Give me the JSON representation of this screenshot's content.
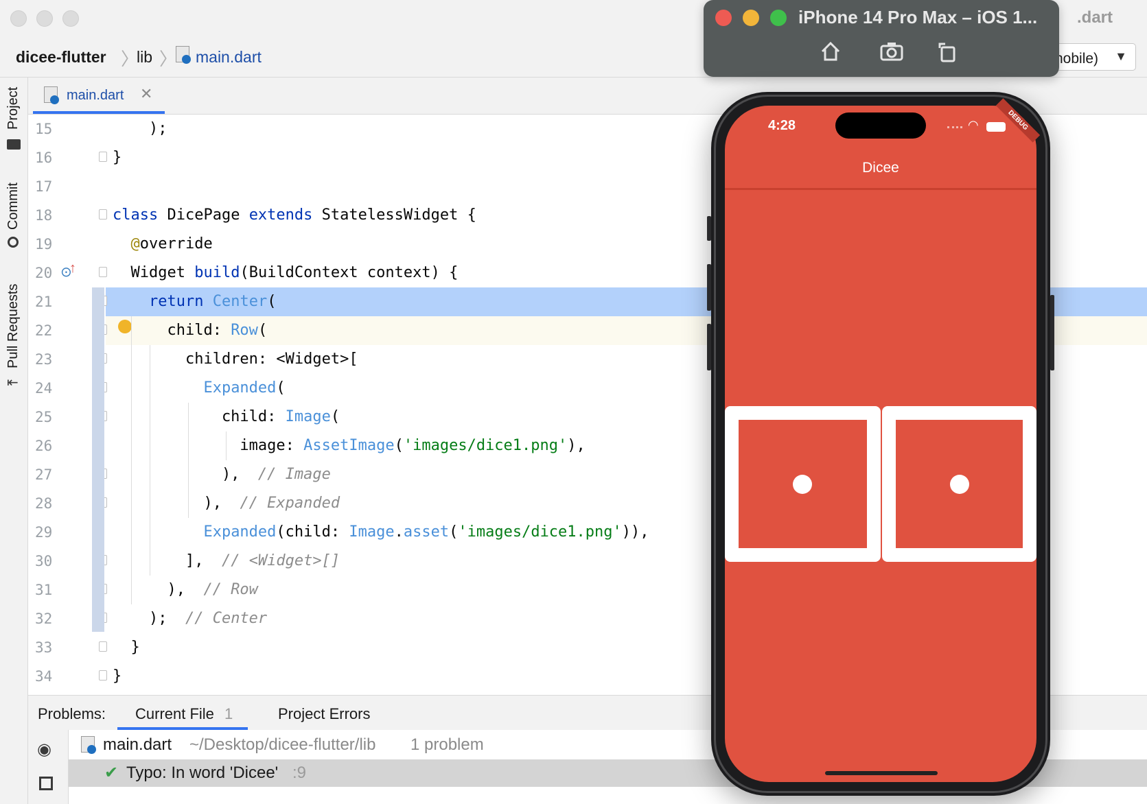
{
  "ide": {
    "breadcrumb": {
      "project": "dicee-flutter",
      "folder": "lib",
      "file": "main.dart"
    },
    "right_title_fragment": ".dart",
    "device_select": {
      "value": "nobile)"
    },
    "tool_windows": [
      "Project",
      "Commit",
      "Pull Requests"
    ],
    "tab": {
      "label": "main.dart"
    },
    "code_lines": [
      {
        "n": "15",
        "text": "    );"
      },
      {
        "n": "16",
        "text": "}"
      },
      {
        "n": "17",
        "text": ""
      },
      {
        "n": "18",
        "text": "class DicePage extends StatelessWidget {"
      },
      {
        "n": "19",
        "text": "  @override"
      },
      {
        "n": "20",
        "text": "  Widget build(BuildContext context) {"
      },
      {
        "n": "21",
        "text": "    return Center("
      },
      {
        "n": "22",
        "text": "      child: Row("
      },
      {
        "n": "23",
        "text": "        children: <Widget>["
      },
      {
        "n": "24",
        "text": "          Expanded("
      },
      {
        "n": "25",
        "text": "            child: Image("
      },
      {
        "n": "26",
        "text": "              image: AssetImage('images/dice1.png'),"
      },
      {
        "n": "27",
        "text": "            ),  // Image"
      },
      {
        "n": "28",
        "text": "          ),  // Expanded"
      },
      {
        "n": "29",
        "text": "          Expanded(child: Image.asset('images/dice1.png')),"
      },
      {
        "n": "30",
        "text": "        ],  // <Widget>[]"
      },
      {
        "n": "31",
        "text": "      ),  // Row"
      },
      {
        "n": "32",
        "text": "    );  // Center"
      },
      {
        "n": "33",
        "text": "  }"
      },
      {
        "n": "34",
        "text": "}"
      }
    ],
    "problems": {
      "title": "Problems:",
      "tabs": [
        {
          "label": "Current File",
          "count": "1"
        },
        {
          "label": "Project Errors",
          "count": ""
        }
      ],
      "file_row": {
        "file": "main.dart",
        "path": "~/Desktop/dicee-flutter/lib",
        "summary": "1 problem"
      },
      "problem_row": {
        "text": "Typo: In word 'Dicee'",
        "location": ":9"
      }
    },
    "colors": {
      "selection": "#b3d1fb",
      "keyword": "#0033b3",
      "class": "#4a90d9",
      "string": "#067d17",
      "comment": "#8c8c8c"
    }
  },
  "simulator": {
    "title": "iPhone 14 Pro Max – iOS 1...",
    "toolbar_icons": [
      "home-icon",
      "screenshot-icon",
      "rotate-icon"
    ],
    "status_time": "4:28",
    "debug_banner": "DEBUG",
    "app_title": "Dicee",
    "background_color": "#e05240",
    "dice": [
      {
        "face": 1
      },
      {
        "face": 1
      }
    ]
  }
}
